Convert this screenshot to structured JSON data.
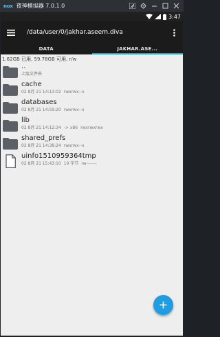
{
  "emulator": {
    "logo": "nox",
    "title": "夜神模拟器 7.0.1.0",
    "controls": [
      "signal-icon",
      "settings-icon",
      "minimize-icon",
      "maximize-icon",
      "close-icon"
    ]
  },
  "statusbar": {
    "time": "3:47"
  },
  "appbar": {
    "path": "/data/user/0/jakhar.aseem.diva"
  },
  "tabs": [
    {
      "label": "DATA",
      "active": false
    },
    {
      "label": "JAKHAR.ASE...",
      "active": true
    }
  ],
  "storage": "1.62GB 已用, 59.78GB 可用, r/w",
  "files": [
    {
      "name": "..",
      "date": "上层文件夹",
      "info": "",
      "perms": "",
      "type": "folder"
    },
    {
      "name": "cache",
      "date": "02 8月 21 14:13:02",
      "info": "",
      "perms": "rwxrwx--x",
      "type": "folder"
    },
    {
      "name": "databases",
      "date": "02 8月 21 14:59:20",
      "info": "",
      "perms": "rwxrwx--x",
      "type": "folder"
    },
    {
      "name": "lib",
      "date": "02 8月 21 14:12:34",
      "info": "-> x86",
      "perms": "rwxrwxrwx",
      "type": "folder"
    },
    {
      "name": "shared_prefs",
      "date": "02 8月 21 14:38:24",
      "info": "",
      "perms": "rwxrwx--x",
      "type": "folder"
    },
    {
      "name": "uinfo1510959364tmp",
      "date": "02 8月 21 15:43:10",
      "info": "19 字节",
      "perms": "rw-------",
      "type": "file"
    }
  ],
  "colors": {
    "accent": "#1e9de3",
    "appbar": "#1b1b1b",
    "folder": "#5a6066",
    "background": "#eeeeee"
  }
}
